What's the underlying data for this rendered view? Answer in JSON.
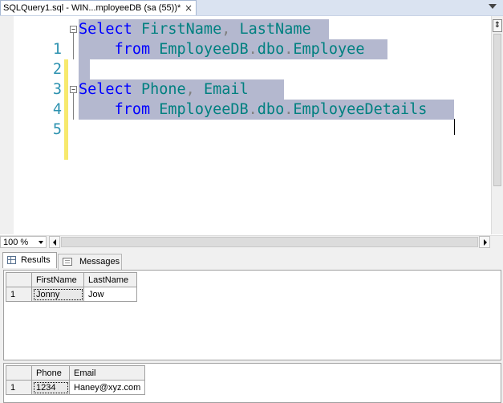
{
  "tab": {
    "title": "SQLQuery1.sql - WIN...mployeeDB (sa (55))*",
    "close": "×"
  },
  "editor": {
    "lines": [
      {
        "n": "1",
        "kw1": "Select",
        "a": "FirstName",
        "p": ",",
        "b": "LastName"
      },
      {
        "n": "2",
        "kw": "from",
        "db": "EmployeeDB",
        "schema": "dbo",
        "table": "Employee"
      },
      {
        "n": "3"
      },
      {
        "n": "4",
        "kw1": "Select",
        "a": "Phone",
        "p": ",",
        "b": "Email"
      },
      {
        "n": "5",
        "kw": "from",
        "db": "EmployeeDB",
        "schema": "dbo",
        "table": "EmployeeDetails"
      }
    ],
    "dot": "."
  },
  "statusbar": {
    "zoom": "100 %"
  },
  "results": {
    "tabs": {
      "results": "Results",
      "messages": "Messages"
    },
    "grid1": {
      "headers": [
        "FirstName",
        "LastName"
      ],
      "rows": [
        {
          "n": "1",
          "cells": [
            "Jonny",
            "Jow"
          ]
        }
      ]
    },
    "grid2": {
      "headers": [
        "Phone",
        "Email"
      ],
      "rows": [
        {
          "n": "1",
          "cells": [
            "1234",
            "Haney@xyz.com"
          ]
        }
      ]
    }
  },
  "colors": {
    "keyword": "#0000ff",
    "object": "#008080",
    "selection": "#b4b8cf",
    "line_number": "#2b91af"
  }
}
